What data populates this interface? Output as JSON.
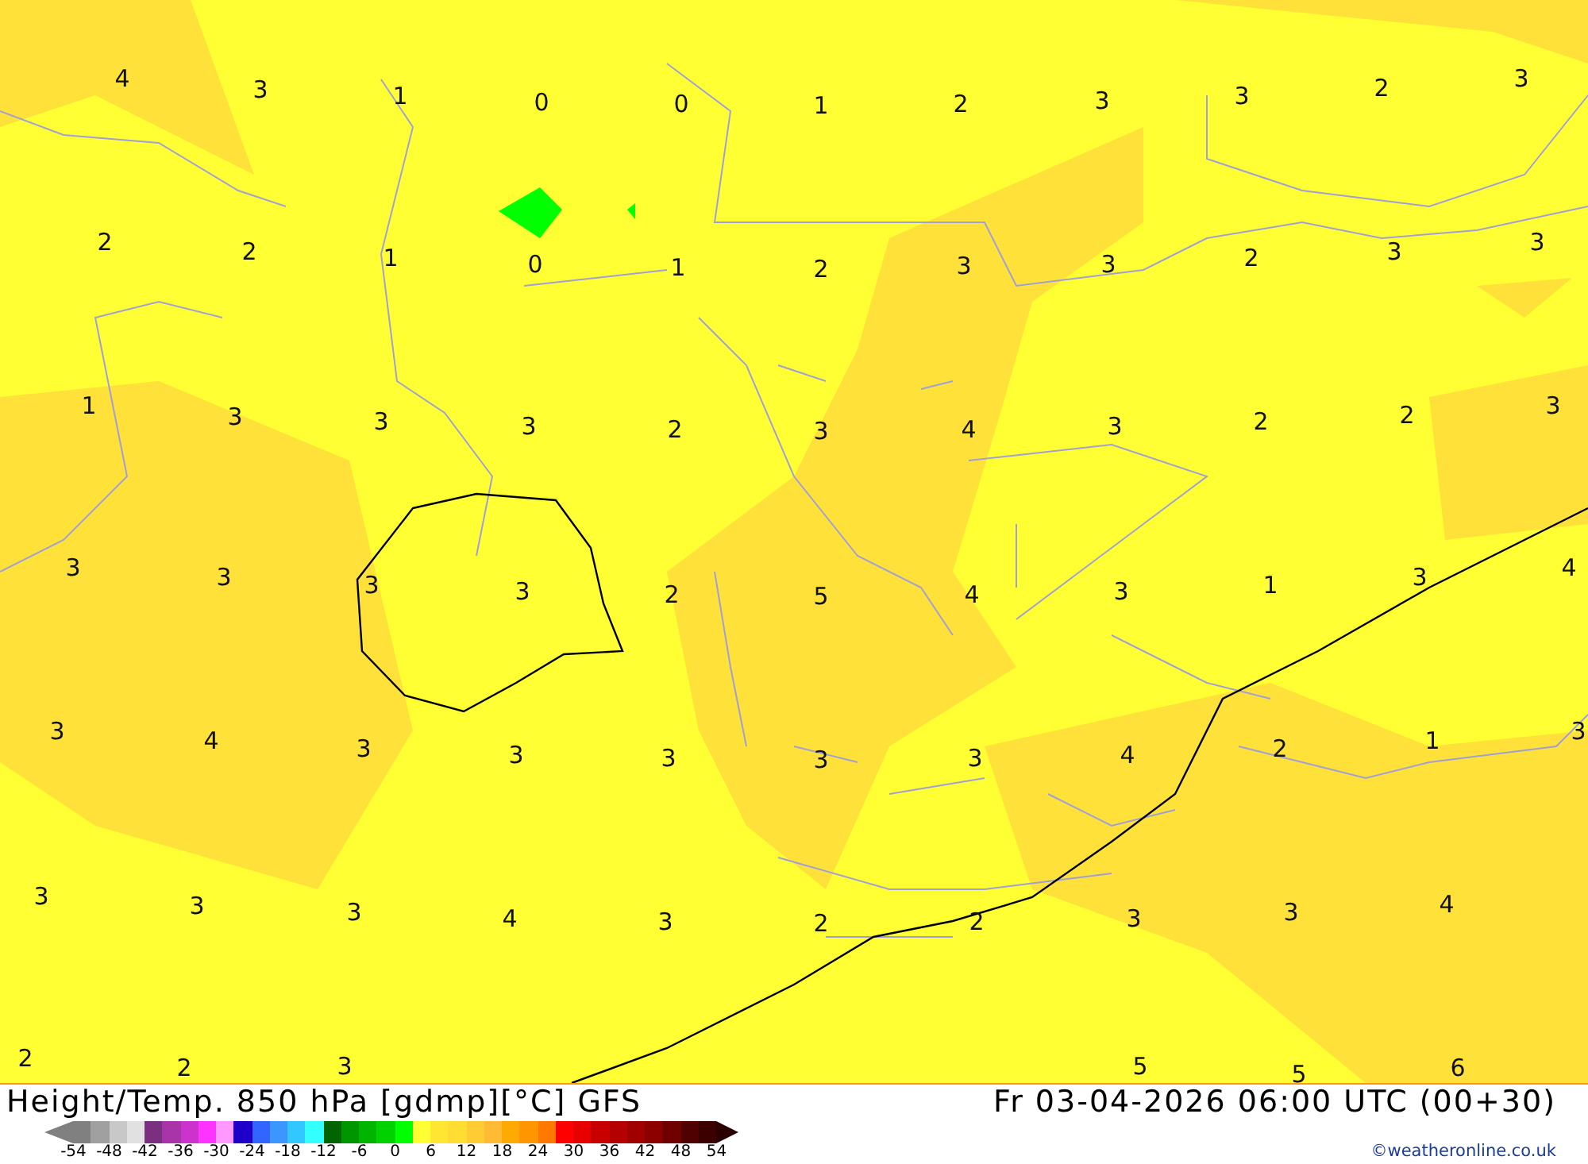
{
  "map": {
    "values": [
      "4",
      "3",
      "1",
      "0",
      "0",
      "1",
      "2",
      "3",
      "3",
      "2",
      "3",
      "2",
      "2",
      "1",
      "0",
      "1",
      "2",
      "3",
      "3",
      "2",
      "3",
      "3",
      "1",
      "3",
      "3",
      "3",
      "2",
      "3",
      "4",
      "3",
      "2",
      "2",
      "3",
      "3",
      "3",
      "3",
      "3",
      "2",
      "5",
      "4",
      "3",
      "1",
      "3",
      "4",
      "3",
      "4",
      "3",
      "3",
      "3",
      "3",
      "3",
      "4",
      "2",
      "1",
      "3",
      "3",
      "3",
      "3",
      "4",
      "3",
      "2",
      "2",
      "3",
      "3",
      "4",
      "2",
      "2",
      "3",
      "5",
      "5",
      "6"
    ]
  },
  "footer": {
    "title": "Height/Temp. 850 hPa [gdmp][°C] GFS",
    "date": "Fr 03-04-2026 06:00 UTC (00+30)",
    "credit": "©weatheronline.co.uk"
  },
  "legend": {
    "swatches": [
      {
        "color": "#808080"
      },
      {
        "color": "#a0a0a0"
      },
      {
        "color": "#c8c8c8"
      },
      {
        "color": "#e1e1e1"
      },
      {
        "color": "#7b2f7f"
      },
      {
        "color": "#a933a9"
      },
      {
        "color": "#cc33cc"
      },
      {
        "color": "#ff33ff"
      },
      {
        "color": "#ff99ff"
      },
      {
        "color": "#1e00c8"
      },
      {
        "color": "#3264ff"
      },
      {
        "color": "#3c96ff"
      },
      {
        "color": "#32c8ff"
      },
      {
        "color": "#33ffff"
      },
      {
        "color": "#006400"
      },
      {
        "color": "#009600"
      },
      {
        "color": "#00b400"
      },
      {
        "color": "#00d200"
      },
      {
        "color": "#00ff00"
      },
      {
        "color": "#ffff33"
      },
      {
        "color": "#ffe633"
      },
      {
        "color": "#ffdd33"
      },
      {
        "color": "#ffcc33"
      },
      {
        "color": "#ffbb33"
      },
      {
        "color": "#ffaa00"
      },
      {
        "color": "#ff9600"
      },
      {
        "color": "#ff7800"
      },
      {
        "color": "#ff0000"
      },
      {
        "color": "#e60000"
      },
      {
        "color": "#c80000"
      },
      {
        "color": "#b40000"
      },
      {
        "color": "#a00000"
      },
      {
        "color": "#8c0000"
      },
      {
        "color": "#6e0000"
      },
      {
        "color": "#500000"
      },
      {
        "color": "#3c0000"
      }
    ],
    "ticks": [
      "-54",
      "-48",
      "-42",
      "-36",
      "-30",
      "-24",
      "-18",
      "-12",
      "-6",
      "0",
      "6",
      "12",
      "18",
      "24",
      "30",
      "36",
      "42",
      "48",
      "54"
    ]
  }
}
